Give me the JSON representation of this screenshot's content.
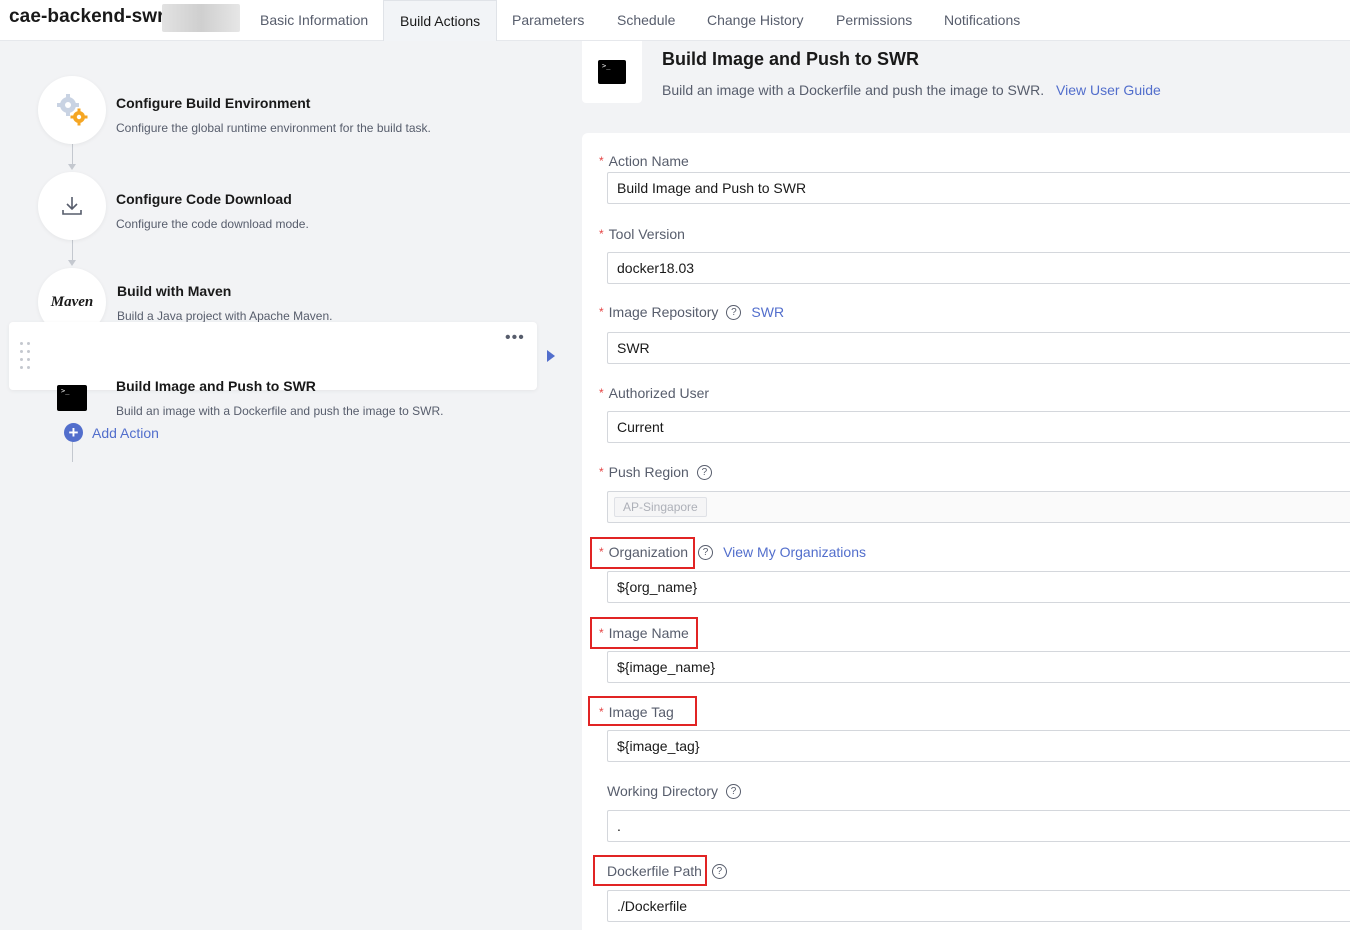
{
  "app": {
    "title": "cae-backend-swr"
  },
  "tabs": [
    {
      "label": "Basic Information",
      "active": false
    },
    {
      "label": "Build Actions",
      "active": true
    },
    {
      "label": "Parameters",
      "active": false
    },
    {
      "label": "Schedule",
      "active": false
    },
    {
      "label": "Change History",
      "active": false
    },
    {
      "label": "Permissions",
      "active": false
    },
    {
      "label": "Notifications",
      "active": false
    }
  ],
  "steps": [
    {
      "title": "Configure Build Environment",
      "desc": "Configure the global runtime environment for the build task.",
      "icon": "gears-icon"
    },
    {
      "title": "Configure Code Download",
      "desc": "Configure the code download mode.",
      "icon": "download-icon"
    },
    {
      "title": "Build with Maven",
      "desc": "Build a Java project with Apache Maven.",
      "icon": "maven-logo",
      "logo_text": "Maven"
    },
    {
      "title": "Build Image and Push to SWR",
      "desc": "Build an image with a Dockerfile and push the image to SWR.",
      "icon": "terminal-icon",
      "active": true
    }
  ],
  "add_action": {
    "label": "Add Action"
  },
  "detail": {
    "title": "Build Image and Push to SWR",
    "desc": "Build an image with a Dockerfile and push the image to SWR.",
    "guide_link": "View User Guide"
  },
  "form": {
    "action_name": {
      "label": "Action Name",
      "value": "Build Image and Push to SWR"
    },
    "tool_version": {
      "label": "Tool Version",
      "value": "docker18.03"
    },
    "image_repository": {
      "label": "Image Repository",
      "link": "SWR",
      "value": "SWR"
    },
    "authorized_user": {
      "label": "Authorized User",
      "value": "Current"
    },
    "push_region": {
      "label": "Push Region",
      "tag": "AP-Singapore"
    },
    "organization": {
      "label": "Organization",
      "link": "View My Organizations",
      "value": "${org_name}"
    },
    "image_name": {
      "label": "Image Name",
      "value": "${image_name}"
    },
    "image_tag": {
      "label": "Image Tag",
      "value": "${image_tag}"
    },
    "working_directory": {
      "label": "Working Directory",
      "value": "."
    },
    "dockerfile_path": {
      "label": "Dockerfile Path",
      "value": "./Dockerfile"
    }
  },
  "colors": {
    "accent": "#526ecc",
    "required": "#e54545",
    "highlight": "#e12424"
  }
}
